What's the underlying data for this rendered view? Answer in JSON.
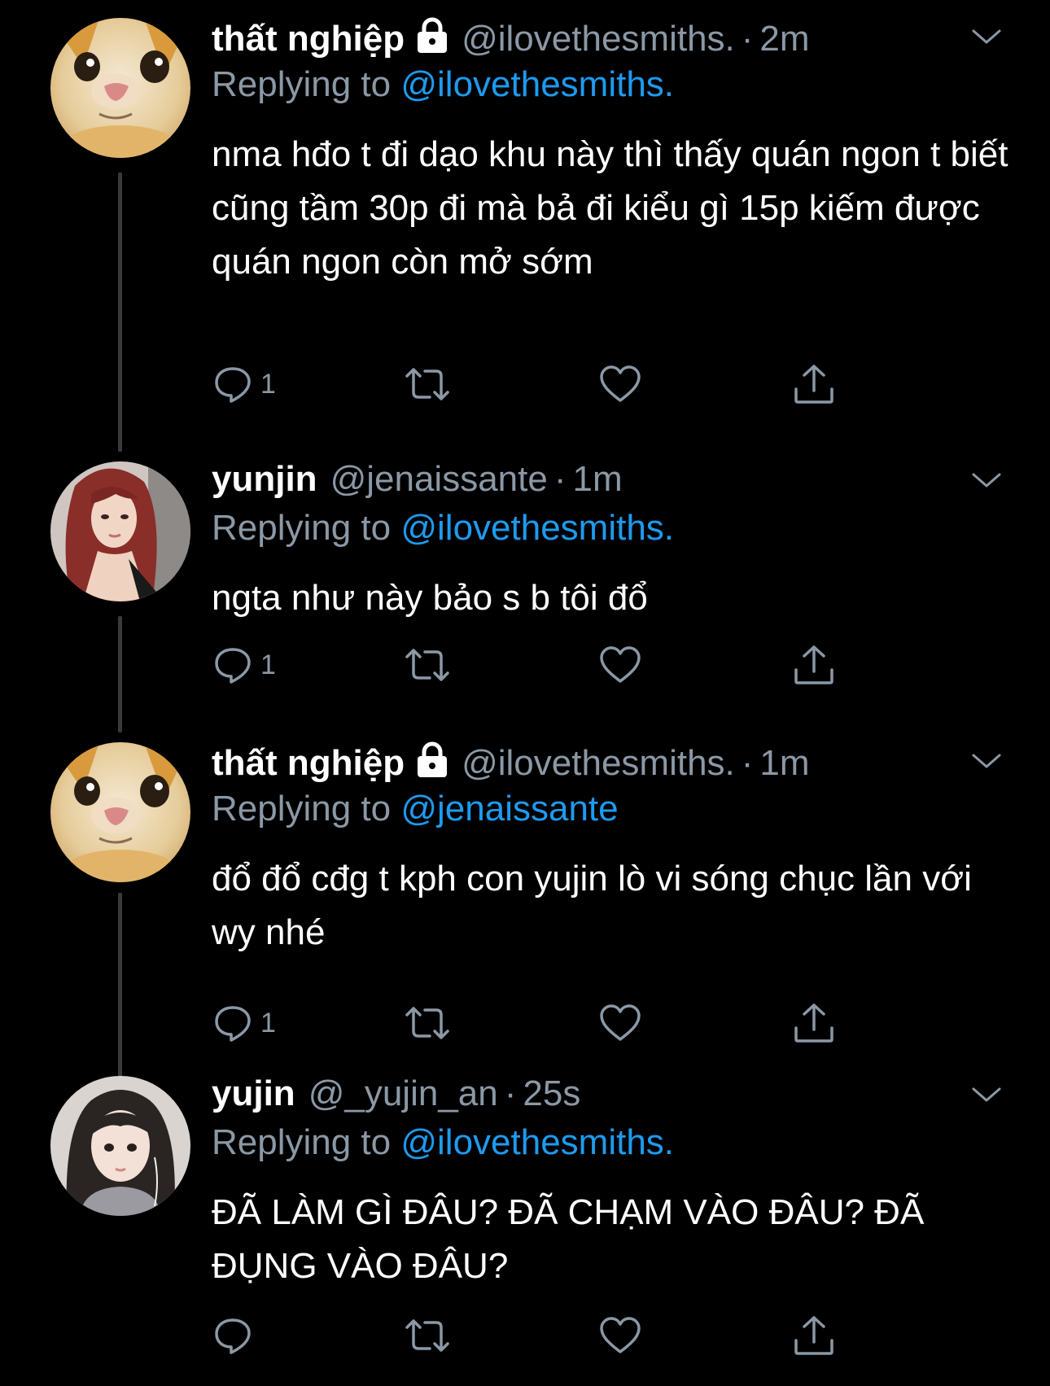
{
  "colors": {
    "background": "#000000",
    "text_primary": "#ffffff",
    "text_secondary": "#8b98a5",
    "mention": "#1d9bf0",
    "thread_line": "#3a3a3c"
  },
  "tweets": [
    {
      "display_name": "thất nghiệp",
      "protected": true,
      "handle": "@ilovethesmiths.",
      "separator": "·",
      "time": "2m",
      "reply_label": "Replying to",
      "reply_to": "@ilovethesmiths.",
      "text": "nma hđo t đi dạo khu này thì thấy quán ngon t biết cũng tầm 30p đi mà bả đi kiểu gì 15p kiếm được quán ngon còn mở sớm",
      "reply_count": "1",
      "avatar": "cat-avatar"
    },
    {
      "display_name": "yunjin",
      "protected": false,
      "handle": "@jenaissante",
      "separator": "·",
      "time": "1m",
      "reply_label": "Replying to",
      "reply_to": "@ilovethesmiths.",
      "text": "ngta như này bảo s b tôi đổ",
      "reply_count": "1",
      "avatar": "red-hair-avatar"
    },
    {
      "display_name": "thất nghiệp",
      "protected": true,
      "handle": "@ilovethesmiths.",
      "separator": "·",
      "time": "1m",
      "reply_label": "Replying to",
      "reply_to": "@jenaissante",
      "text": "đổ đổ cđg t kph con yujin lò vi sóng chục lần với  wy nhé",
      "reply_count": "1",
      "avatar": "cat-avatar"
    },
    {
      "display_name": "yujin",
      "protected": false,
      "handle": "@_yujin_an",
      "separator": "·",
      "time": "25s",
      "reply_label": "Replying to",
      "reply_to": "@ilovethesmiths.",
      "text": "ĐÃ LÀM GÌ ĐÂU? ĐÃ CHẠM VÀO ĐÂU? ĐÃ ĐỤNG VÀO ĐÂU?",
      "reply_count": "",
      "avatar": "short-hair-avatar"
    }
  ]
}
